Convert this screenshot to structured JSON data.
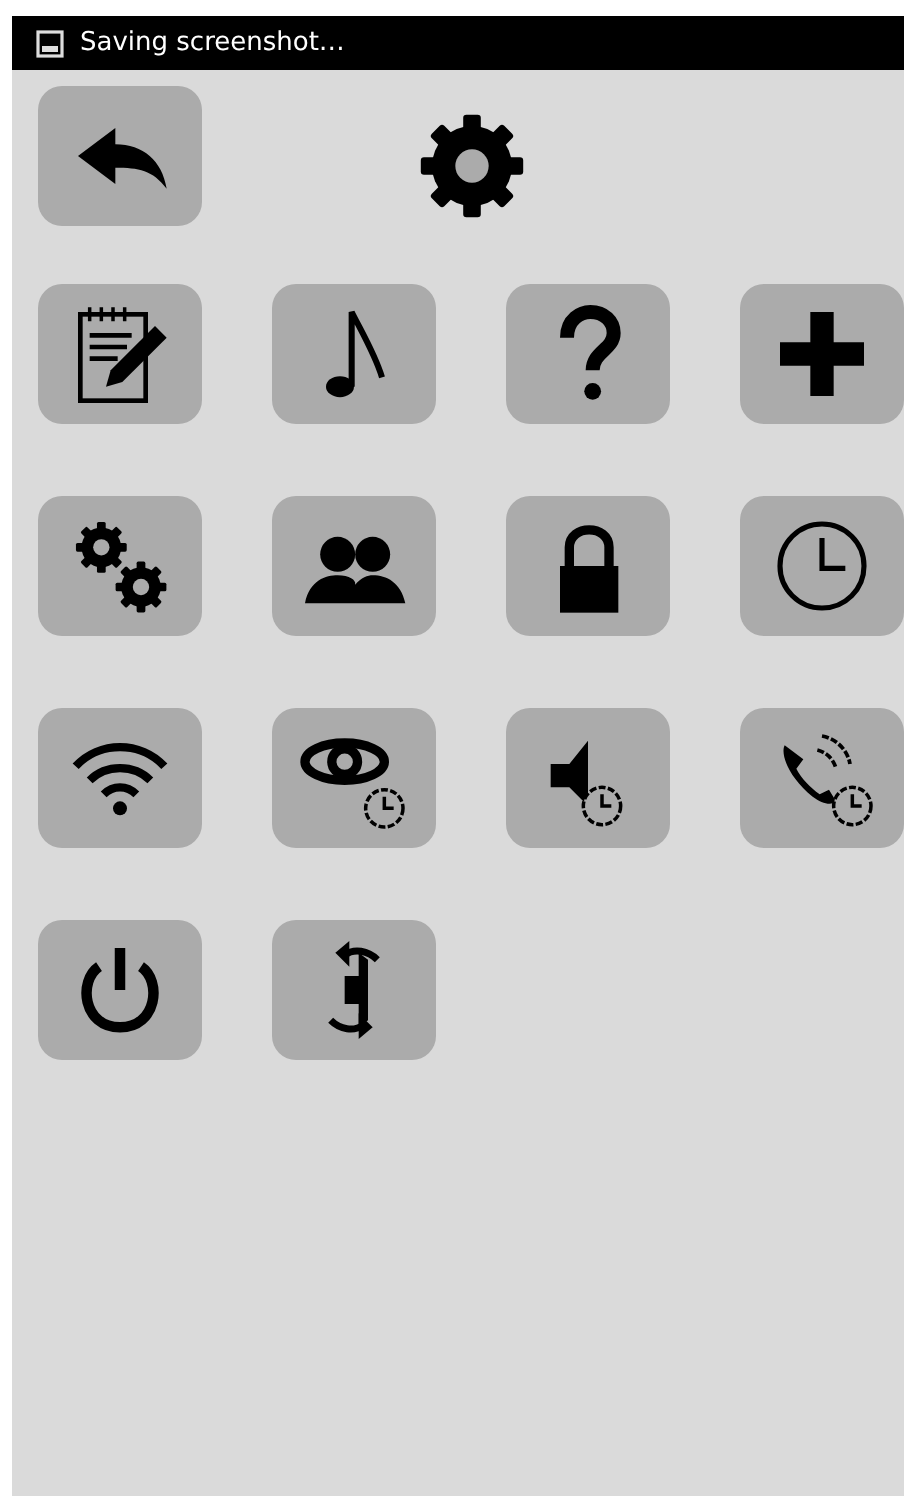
{
  "status_bar": {
    "text": "Saving screenshot…"
  },
  "header": {
    "back_button": {
      "kind": "back"
    },
    "title_icon": {
      "kind": "gear"
    }
  },
  "buttons": [
    {
      "kind": "notes"
    },
    {
      "kind": "music"
    },
    {
      "kind": "help"
    },
    {
      "kind": "add"
    },
    {
      "kind": "settings"
    },
    {
      "kind": "people"
    },
    {
      "kind": "lock"
    },
    {
      "kind": "clock"
    },
    {
      "kind": "wifi"
    },
    {
      "kind": "eyetimer"
    },
    {
      "kind": "volumetimer"
    },
    {
      "kind": "calltimer"
    },
    {
      "kind": "power"
    },
    {
      "kind": "rotate"
    }
  ]
}
